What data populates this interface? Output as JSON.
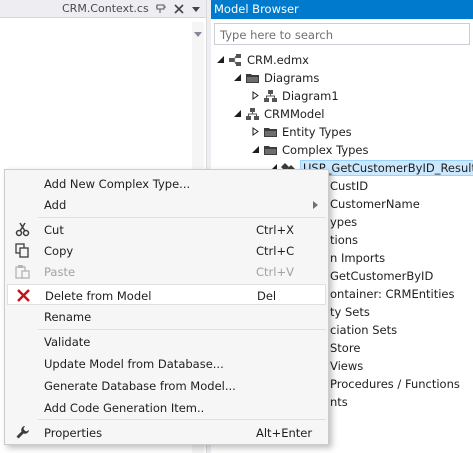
{
  "editor": {
    "tab_title": "CRM.Context.cs",
    "pin_icon": "pin-icon",
    "close_icon": "close-icon",
    "dropdown_icon": "chevron-down-icon"
  },
  "model_browser": {
    "title": "Model Browser",
    "search_placeholder": "Type here to search",
    "tree": {
      "edmx": "CRM.edmx",
      "diagrams": "Diagrams",
      "diagram1": "Diagram1",
      "model": "CRMModel",
      "entity_types": "Entity Types",
      "complex_types": "Complex Types",
      "complex_item": "USP_GetCustomerByID_Result",
      "partial_lines": [
        "CustID",
        "CustomerName",
        "ypes",
        "tions",
        "n Imports",
        "GetCustomerByID",
        "ontainer: CRMEntities",
        "ty Sets",
        "ciation Sets",
        "Store",
        "Views",
        "Procedures / Functions",
        "nts"
      ]
    }
  },
  "context_menu": {
    "items": [
      {
        "label": "Add New Complex Type...",
        "shortcut": "",
        "icon": ""
      },
      {
        "label": "Add",
        "shortcut": "",
        "icon": "submenu-arrow-icon"
      },
      {
        "label": "Cut",
        "shortcut": "Ctrl+X",
        "icon": "scissors-icon"
      },
      {
        "label": "Copy",
        "shortcut": "Ctrl+C",
        "icon": "copy-icon"
      },
      {
        "label": "Paste",
        "shortcut": "Ctrl+V",
        "icon": "paste-icon",
        "disabled": true
      },
      {
        "label": "Delete from Model",
        "shortcut": "Del",
        "icon": "delete-x-icon"
      },
      {
        "label": "Rename",
        "shortcut": "",
        "icon": ""
      },
      {
        "label": "Validate",
        "shortcut": "",
        "icon": ""
      },
      {
        "label": "Update Model from Database...",
        "shortcut": "",
        "icon": ""
      },
      {
        "label": "Generate Database from Model...",
        "shortcut": "",
        "icon": ""
      },
      {
        "label": "Add Code Generation Item..",
        "shortcut": "",
        "icon": ""
      },
      {
        "label": "Properties",
        "shortcut": "Alt+Enter",
        "icon": "wrench-icon"
      }
    ]
  },
  "colors": {
    "accent": "#007acc",
    "delete_icon": "#c5141b",
    "selection": "#cce8ff",
    "menu_background": "#f6f6f6"
  }
}
